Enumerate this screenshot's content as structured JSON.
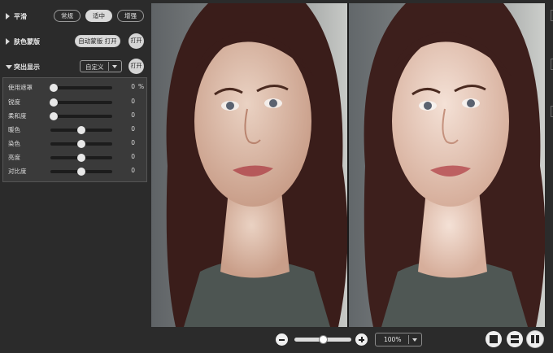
{
  "left_panel": {
    "smoothing": {
      "title": "平滑",
      "options": [
        {
          "label": "常规",
          "active": false
        },
        {
          "label": "适中",
          "active": true
        },
        {
          "label": "增强",
          "active": false
        }
      ]
    },
    "skin_mask": {
      "title": "肤色蒙版",
      "auto_button": "自动蒙版 打开",
      "toggle_button": "打开"
    },
    "highlight": {
      "title": "突出显示",
      "preset_value": "自定义",
      "toggle_button": "打开"
    },
    "adjustments": [
      {
        "label": "使用遮罩",
        "value": "0",
        "unit": "%",
        "level": 0.05
      },
      {
        "label": "锐度",
        "value": "0",
        "unit": "",
        "level": 0.05
      },
      {
        "label": "柔和度",
        "value": "0",
        "unit": "",
        "level": 0.05
      },
      {
        "label": "暖色",
        "value": "0",
        "unit": "",
        "level": 0.5
      },
      {
        "label": "染色",
        "value": "0",
        "unit": "",
        "level": 0.5
      },
      {
        "label": "亮度",
        "value": "0",
        "unit": "",
        "level": 0.5
      },
      {
        "label": "对比度",
        "value": "0",
        "unit": "",
        "level": 0.5
      }
    ]
  },
  "toolbar": {
    "zoom_level": "100%",
    "zoom_slider_level": 0.5,
    "zoom_out_icon": "minus-circle-icon",
    "zoom_in_icon": "plus-circle-icon",
    "view_modes": [
      {
        "name": "single-view-icon",
        "selected": false
      },
      {
        "name": "split-horizontal-icon",
        "selected": false
      },
      {
        "name": "split-vertical-icon",
        "selected": true
      }
    ]
  },
  "colors": {
    "panel_bg": "#2b2b2b",
    "adjust_box_bg": "#3a3a3a",
    "accent_light": "#d9d9d9"
  }
}
